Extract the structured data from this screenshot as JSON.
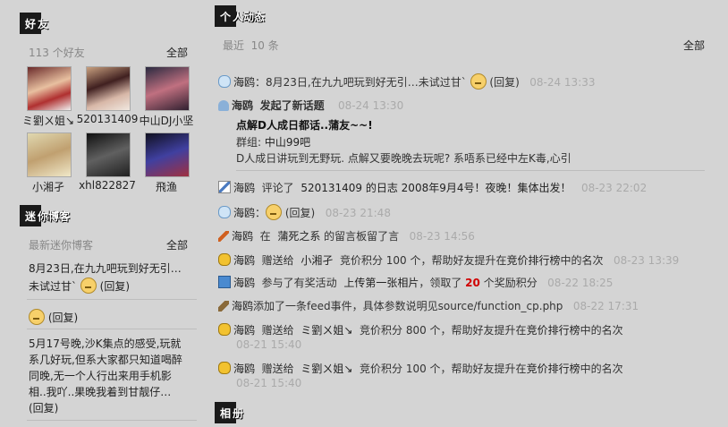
{
  "friends": {
    "header_icon": "好",
    "header_rest": "友",
    "count": "113 个好友",
    "all": "全部",
    "list": [
      {
        "name": "ミ劉ㄨ姐↘"
      },
      {
        "name": "520131409"
      },
      {
        "name": "中山DJ小坚"
      },
      {
        "name": "小湘孑"
      },
      {
        "name": "xhl822827"
      },
      {
        "name": "飛渔"
      }
    ]
  },
  "miniblog": {
    "header_icon": "迷",
    "header_rest": "你博客",
    "latest": "最新迷你博客",
    "all": "全部",
    "entries": [
      {
        "line1": "8月23日,在九九吧玩到好无引…",
        "line2": "未试过甘`",
        "reply": "(回复)"
      },
      {
        "reply": "(回复)"
      },
      {
        "line1": "5月17号晚,沙K集点的感受,玩就",
        "line2": "系几好玩,但系大家都只知道喝醉",
        "line3": "同晚,无一个人行出来用手机影",
        "line4": "相..我吖..果晚我着到甘靓仔…",
        "reply": "(回复)"
      }
    ]
  },
  "feed": {
    "header_icon": "个",
    "header_rest": "人动态",
    "recent": "最近",
    "recent_count": "10 条",
    "all": "全部",
    "items": [
      {
        "user": "海鸥",
        "text": "：8月23日,在九九吧玩到好无引…未试过甘`",
        "reply": "(回复)",
        "time": "08-24 13:33",
        "icon": "chat-icon"
      },
      {
        "user": "海鸥",
        "action": "发起了新话题",
        "time": "08-24 13:30",
        "topic_title": "点解D人成日都话..蒲友~~!",
        "group_label": "群组:",
        "group_name": "中山99吧",
        "topic_body": "D人成日讲玩到无野玩. 点解又要晚晚去玩呢? 系唔系已经中左K毒,心引",
        "icon": "user-icon"
      },
      {
        "user": "海鸥",
        "text": "评论了",
        "target": "520131409 的日志",
        "target2": "2008年9月4号！夜晚！集体出发！",
        "time": "08-23 22:02",
        "icon": "edit-icon"
      },
      {
        "user": "海鸥",
        "text": "：",
        "reply": "(回复)",
        "time": "08-23 21:48",
        "icon": "chat-icon"
      },
      {
        "user": "海鸥",
        "text": "在",
        "target": "蒲死之系",
        "text2": "的留言板留了言",
        "time": "08-23 14:56",
        "icon": "pencil-icon"
      },
      {
        "user": "海鸥",
        "text": "赠送给",
        "target": "小湘孑",
        "text2": "竞价积分  100 个，帮助好友提升在",
        "target2": "竞价排行榜",
        "text3": "中的名次",
        "time": "08-23 13:39",
        "icon": "coins-icon"
      },
      {
        "user": "海鸥",
        "text": "参与了有奖活动",
        "target": "上传第一张相片",
        "text2": "，领取了",
        "num": "20",
        "text3": "个奖励积分",
        "time": "08-22 18:25",
        "icon": "gift-icon"
      },
      {
        "user": "海鸥",
        "text": "添加了一条feed事件，具体参数说明见source/function_cp.php",
        "time": "08-22 17:31",
        "icon": "tool-icon"
      },
      {
        "user": "海鸥",
        "text": "赠送给",
        "target": "ミ劉ㄨ姐↘",
        "text2": "竞价积分  800 个，帮助好友提升在",
        "target2": "竞价排行榜",
        "text3": "中的名次",
        "time": "08-21 15:40",
        "icon": "coins-icon"
      },
      {
        "user": "海鸥",
        "text": "赠送给",
        "target": "ミ劉ㄨ姐↘",
        "text2": "竞价积分  100 个，帮助好友提升在",
        "target2": "竞价排行榜",
        "text3": "中的名次",
        "time": "08-21 15:40",
        "icon": "coins-icon"
      }
    ]
  },
  "album": {
    "header_icon": "相",
    "header_rest": "册"
  }
}
